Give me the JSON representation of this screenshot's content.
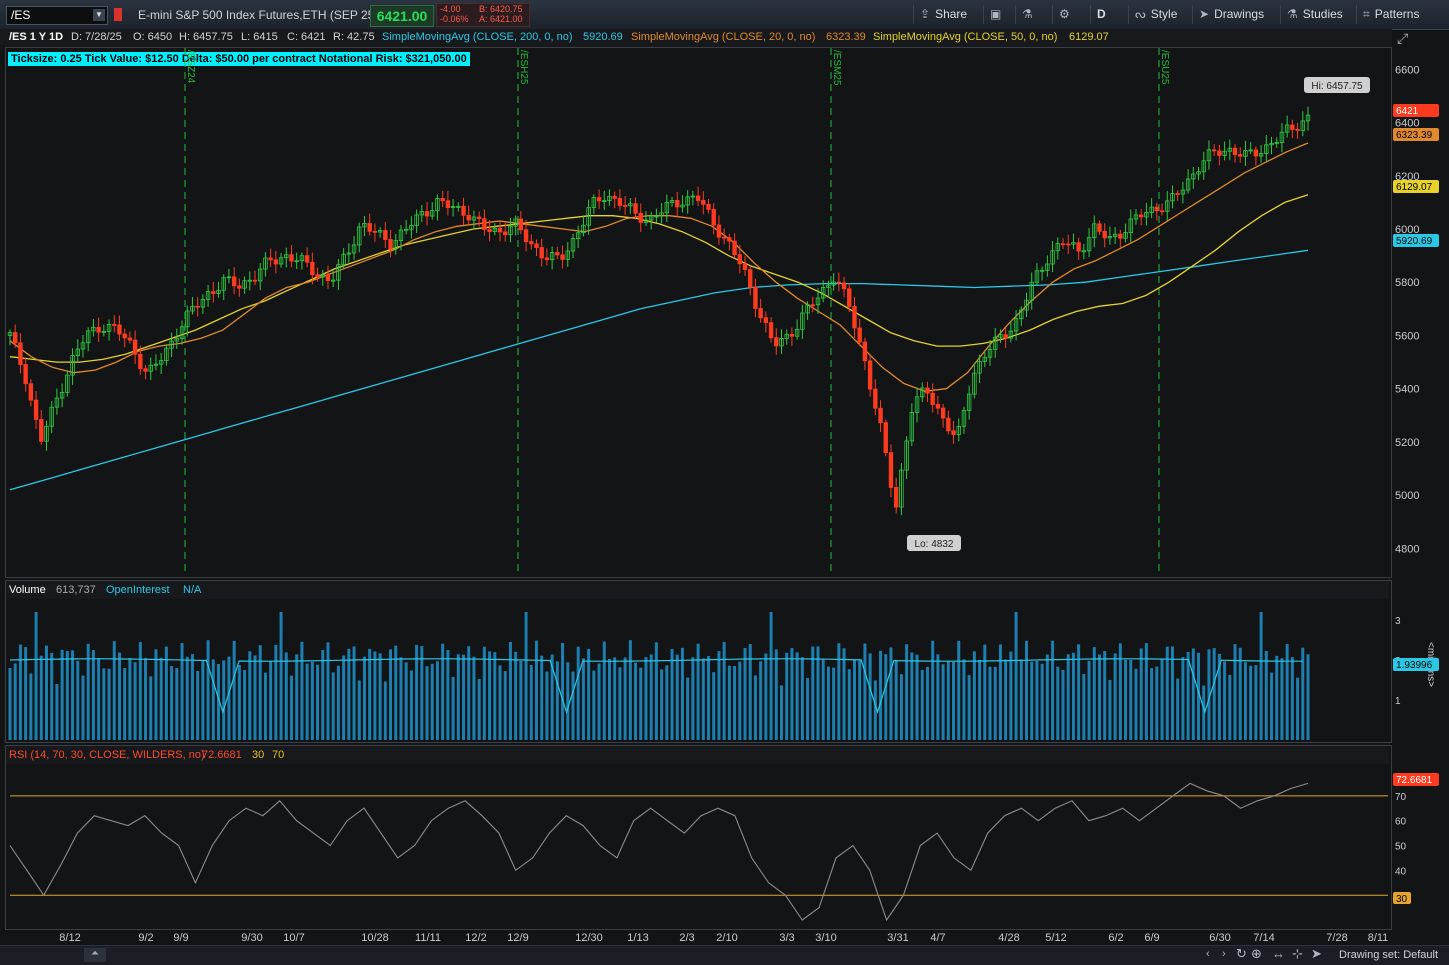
{
  "toolbar": {
    "symbol": "/ES",
    "description": "E-mini S&P 500 Index Futures,ETH (SEP 25)",
    "last_price": "6421.00",
    "net_change": "-4.00",
    "pct_change": "-0.06%",
    "bid": "B: 6420.75",
    "ask": "A: 6421.00",
    "buttons": {
      "share": "Share",
      "aggregation": "D",
      "style": "Style",
      "drawings": "Drawings",
      "studies": "Studies",
      "patterns": "Patterns"
    }
  },
  "info": {
    "title": "/ES 1 Y 1D",
    "date": "D: 7/28/25",
    "open": "O: 6450",
    "high": "H: 6457.75",
    "low": "L: 6415",
    "close": "C: 6421",
    "range": "R: 42.75",
    "sma200_label": "SimpleMovingAvg (CLOSE, 200, 0, no)",
    "sma200_value": "5920.69",
    "sma20_label": "SimpleMovingAvg (CLOSE, 20, 0, no)",
    "sma20_value": "6323.39",
    "sma50_label": "SimpleMovingAvg (CLOSE, 50, 0, no)",
    "sma50_value": "6129.07",
    "ticksize_line": "Ticksize: 0.25  Tick Value: $12.50  Delta: $50.00 per contract  Notational Risk: $321,050.00"
  },
  "volume_header": {
    "label": "Volume",
    "value": "613,737",
    "oi_label": "OpenInterest",
    "oi_value": "N/A",
    "oi_tag": "1.93996",
    "unit": "<millions>"
  },
  "rsi_header": {
    "label": "RSI (14, 70, 30, CLOSE, WILDERS, no)",
    "value": "72.6681",
    "os": "30",
    "ob": "70"
  },
  "bottom": {
    "drawing_set": "Drawing set: Default"
  },
  "colors": {
    "up": "#2ecc40",
    "down": "#ff3b1f",
    "sma20": "#e08a2c",
    "sma50": "#e6d22a",
    "sma200": "#29c9e6",
    "rsi": "#8c8c8c"
  },
  "chart_data": {
    "type": "candlestick",
    "price_axis": {
      "ticks": [
        4800,
        5000,
        5200,
        5400,
        5600,
        5800,
        6000,
        6200,
        6400,
        6600
      ],
      "range": [
        4700,
        6680
      ]
    },
    "x_ticks": [
      "8/12",
      "9/2",
      "9/9",
      "9/30",
      "10/7",
      "10/28",
      "11/11",
      "12/2",
      "12/9",
      "12/30",
      "1/13",
      "2/3",
      "2/10",
      "3/3",
      "3/10",
      "3/31",
      "4/7",
      "4/28",
      "5/12",
      "6/2",
      "6/9",
      "6/30",
      "7/14",
      "7/28",
      "8/11"
    ],
    "rollover_lines": [
      {
        "label": "/ESZ24"
      },
      {
        "label": "/ESH25"
      },
      {
        "label": "/ESM25"
      },
      {
        "label": "/ESU25"
      }
    ],
    "price_tags": {
      "last": "6421",
      "sma20": "6323.39",
      "sma50": "6129.07",
      "sma200": "5920.69"
    },
    "hi_label": "Hi: 6457.75",
    "lo_label": "Lo: 4832",
    "close_path": [
      5600,
      5450,
      5200,
      5350,
      5500,
      5600,
      5640,
      5620,
      5560,
      5450,
      5520,
      5620,
      5700,
      5760,
      5800,
      5790,
      5820,
      5880,
      5900,
      5880,
      5840,
      5800,
      5900,
      6020,
      5980,
      5950,
      6000,
      6060,
      6100,
      6080,
      6060,
      6000,
      5990,
      6020,
      5950,
      5900,
      5880,
      5970,
      6080,
      6130,
      6100,
      6050,
      6040,
      6080,
      6110,
      6120,
      6030,
      5950,
      5850,
      5700,
      5560,
      5600,
      5680,
      5750,
      5830,
      5700,
      5500,
      5250,
      4950,
      5320,
      5400,
      5300,
      5200,
      5450,
      5540,
      5600,
      5660,
      5800,
      5900,
      5950,
      5920,
      6000,
      5960,
      6000,
      6050,
      6080,
      6100,
      6170,
      6250,
      6290,
      6300,
      6270,
      6300,
      6340,
      6380,
      6421
    ],
    "sma20_path": [
      5580,
      5520,
      5480,
      5460,
      5470,
      5500,
      5540,
      5560,
      5570,
      5590,
      5620,
      5680,
      5740,
      5780,
      5800,
      5830,
      5860,
      5890,
      5920,
      5960,
      5990,
      6010,
      6020,
      6030,
      6020,
      6010,
      6000,
      5990,
      6010,
      6040,
      6050,
      6050,
      6040,
      6010,
      5950,
      5870,
      5800,
      5740,
      5690,
      5640,
      5560,
      5480,
      5420,
      5390,
      5400,
      5460,
      5560,
      5650,
      5730,
      5800,
      5850,
      5880,
      5920,
      5960,
      6010,
      6060,
      6110,
      6160,
      6210,
      6250,
      6290,
      6323
    ],
    "sma50_path": [
      5520,
      5510,
      5500,
      5500,
      5510,
      5530,
      5560,
      5590,
      5620,
      5660,
      5700,
      5730,
      5770,
      5810,
      5850,
      5880,
      5910,
      5940,
      5960,
      5980,
      6000,
      6010,
      6020,
      6030,
      6040,
      6050,
      6050,
      6040,
      6020,
      5990,
      5950,
      5900,
      5860,
      5830,
      5800,
      5760,
      5710,
      5660,
      5610,
      5580,
      5560,
      5560,
      5570,
      5590,
      5620,
      5660,
      5690,
      5710,
      5720,
      5750,
      5800,
      5860,
      5920,
      5990,
      6050,
      6100,
      6129
    ],
    "sma200_path": [
      5020,
      5060,
      5100,
      5140,
      5180,
      5220,
      5260,
      5300,
      5340,
      5380,
      5420,
      5460,
      5500,
      5540,
      5580,
      5620,
      5660,
      5700,
      5730,
      5760,
      5780,
      5790,
      5795,
      5795,
      5790,
      5785,
      5780,
      5785,
      5790,
      5800,
      5820,
      5840,
      5860,
      5880,
      5900,
      5920
    ],
    "volume_axis": {
      "ticks": [
        1,
        2,
        3
      ],
      "unit": "millions"
    },
    "rsi_axis": {
      "ticks": [
        30,
        40,
        50,
        60,
        70
      ],
      "overbought": 70,
      "oversold": 30
    },
    "rsi_path": [
      50,
      40,
      30,
      42,
      55,
      62,
      60,
      58,
      62,
      55,
      50,
      35,
      50,
      60,
      65,
      62,
      68,
      60,
      55,
      50,
      60,
      65,
      55,
      45,
      50,
      60,
      65,
      68,
      62,
      55,
      40,
      45,
      55,
      62,
      58,
      50,
      45,
      60,
      65,
      60,
      55,
      62,
      65,
      62,
      45,
      35,
      30,
      20,
      25,
      45,
      50,
      40,
      20,
      30,
      50,
      55,
      45,
      40,
      55,
      62,
      65,
      60,
      65,
      68,
      60,
      62,
      65,
      60,
      65,
      70,
      75,
      72,
      70,
      65,
      68,
      70,
      73,
      75
    ]
  }
}
